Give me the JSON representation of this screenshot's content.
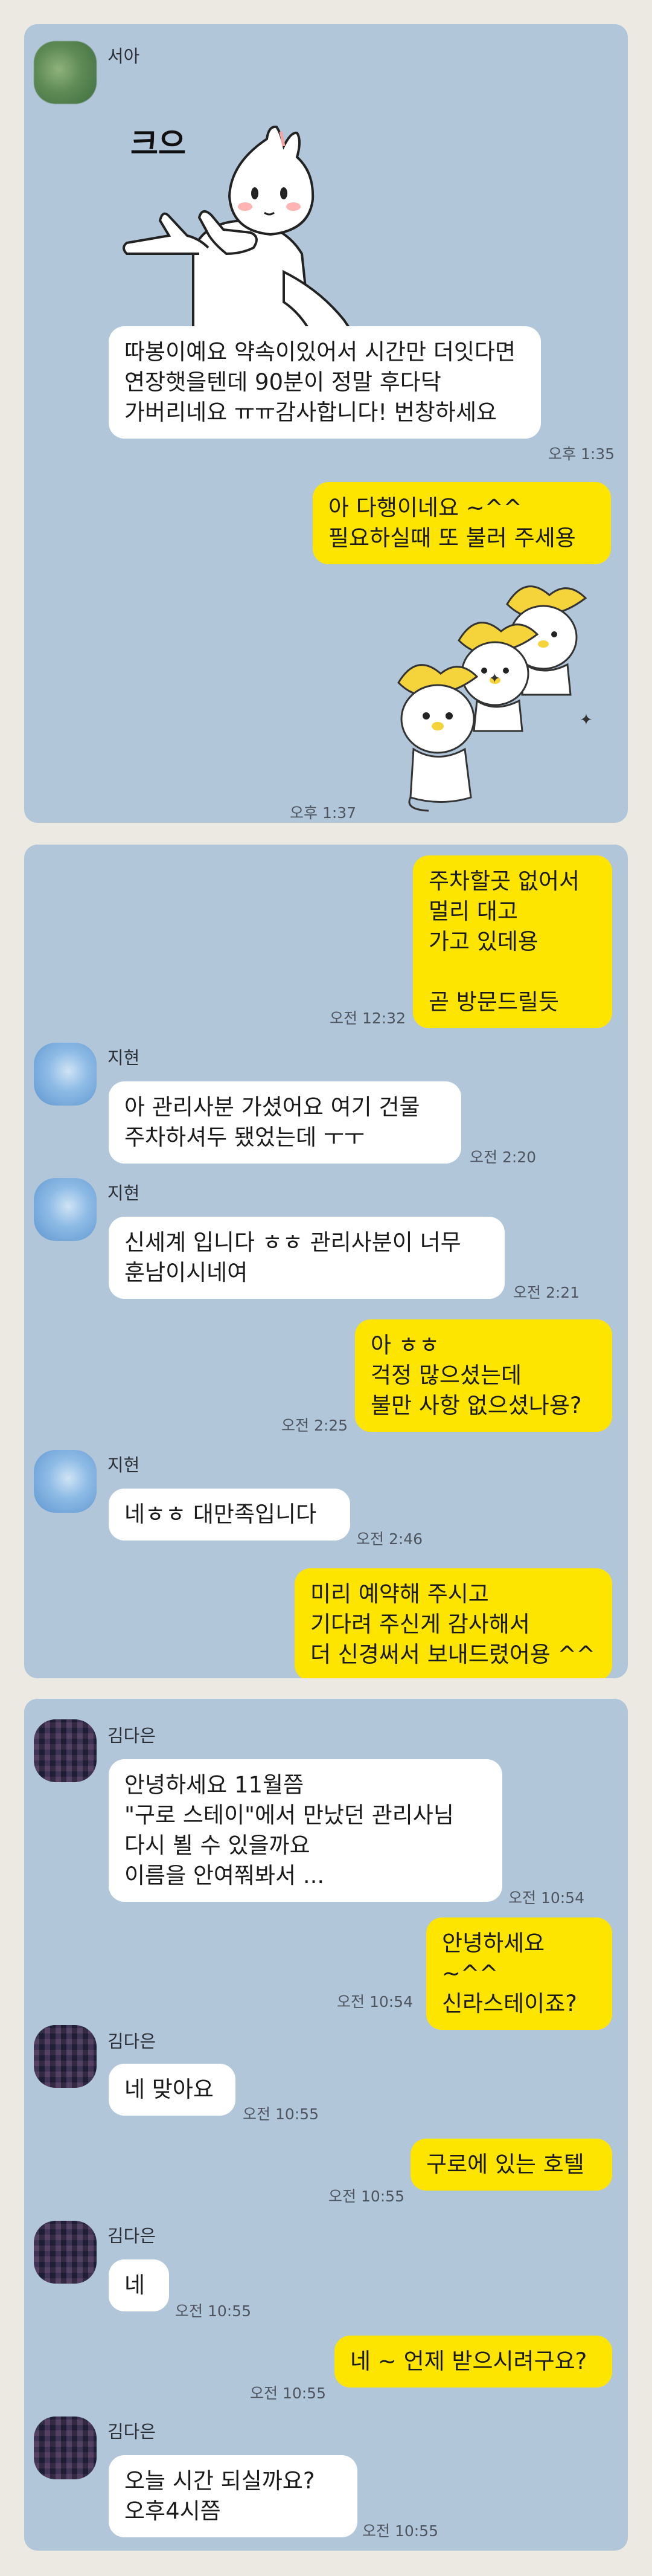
{
  "chats": [
    {
      "messages": [
        {
          "sender": "서아",
          "sticker_text": "크으",
          "text": "따봉이예요 약속이있어서 시간만 더잇다면 연장햇을텐데 90분이 정말 후다닥 가버리네요 ㅠㅠ감사합니다! 번창하세요",
          "time": "오후 1:35"
        },
        {
          "text": "아 다행이네요 ~^^\n필요하실때 또 불러 주세용",
          "sticker": "three-dancing-bunnies",
          "time": "오후 1:37"
        }
      ]
    },
    {
      "messages": [
        {
          "text": "주차할곳 없어서\n멀리 대고\n가고 있데용\n\n곧 방문드릴듯",
          "time": "오전 12:32"
        },
        {
          "sender": "지현",
          "text": "아 관리사분 가셨어요 여기 건물\n주차하셔두 됐었는데 ㅜㅜ",
          "time": "오전 2:20"
        },
        {
          "sender": "지현",
          "text": "신세계 입니다 ㅎㅎ 관리사분이 너무\n훈남이시네여",
          "time": "오전 2:21"
        },
        {
          "text": "아 ㅎㅎ\n걱정 많으셨는데\n불만 사항 없으셨나용?",
          "time": "오전 2:25"
        },
        {
          "sender": "지현",
          "text": "네ㅎㅎ 대만족입니다",
          "time": "오전 2:46"
        },
        {
          "text": "미리 예약해 주시고\n기다려 주신게 감사해서\n더 신경써서 보내드렸어용 ^^"
        }
      ]
    },
    {
      "messages": [
        {
          "sender": "김다은",
          "text": "안녕하세요 11월쯤\n\"구로 스테이\"에서 만났던 관리사님\n다시 뵐 수 있을까요\n이름을 안여쭤봐서 ...",
          "time": "오전 10:54"
        },
        {
          "text": "안녕하세요 ~^^\n신라스테이죠?",
          "time": "오전 10:54"
        },
        {
          "sender": "김다은",
          "text": "네 맞아요",
          "time": "오전 10:55"
        },
        {
          "text": "구로에 있는 호텔",
          "time": "오전 10:55"
        },
        {
          "sender": "김다은",
          "text": "네",
          "time": "오전 10:55"
        },
        {
          "text": "네 ~ 언제 받으시려구요?",
          "time": "오전 10:55"
        },
        {
          "sender": "김다은",
          "text": "오늘  시간 되실까요?\n오후4시쯤",
          "time": "오전 10:55"
        }
      ]
    }
  ]
}
